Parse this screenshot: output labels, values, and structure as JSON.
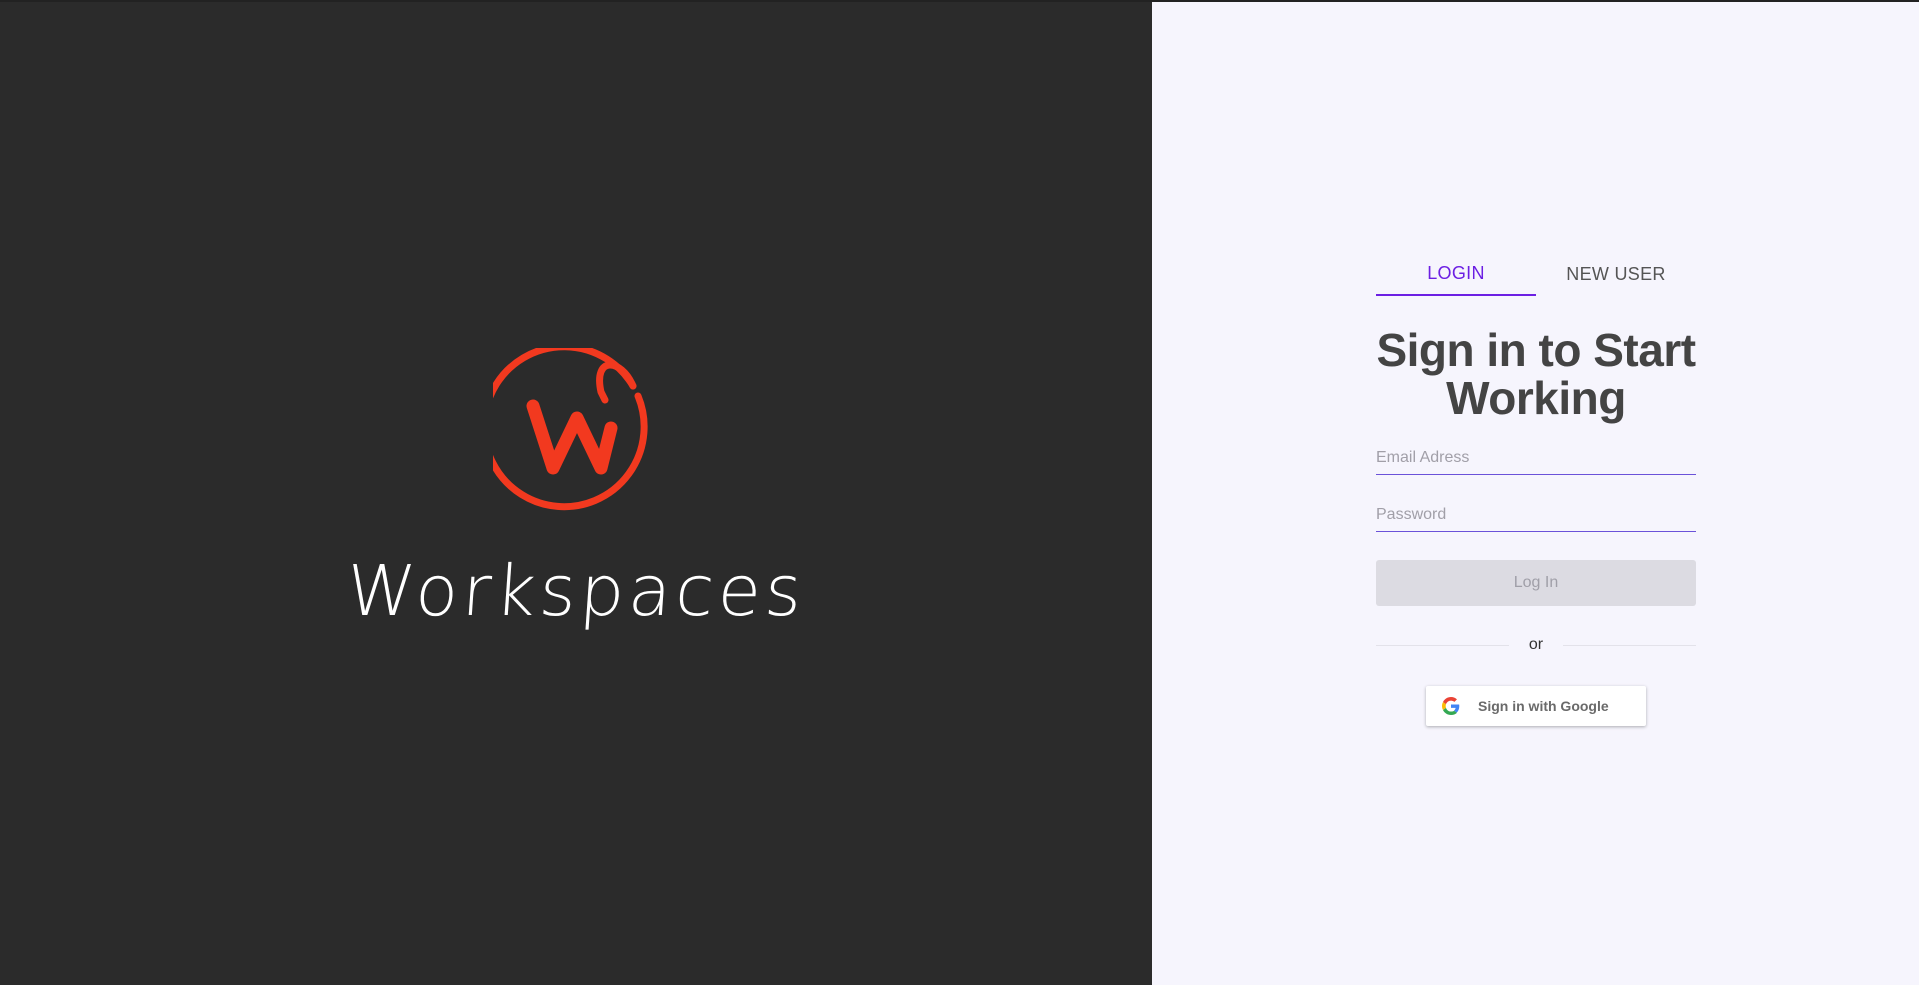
{
  "brand": {
    "name": "Workspaces",
    "logo_icon": "workspaces-w-logo-icon",
    "logo_color": "#f2391f"
  },
  "tabs": [
    {
      "label": "LOGIN",
      "active": true
    },
    {
      "label": "NEW USER",
      "active": false
    }
  ],
  "auth": {
    "heading": "Sign in to Start Working",
    "email": {
      "placeholder": "Email Adress",
      "value": ""
    },
    "password": {
      "placeholder": "Password",
      "value": ""
    },
    "login_label": "Log In",
    "divider_label": "or",
    "google_label": "Sign in with Google",
    "google_icon": "google-g-icon"
  },
  "colors": {
    "left_bg": "#2b2b2b",
    "right_bg": "#f6f5fd",
    "accent": "#6c1fe3"
  }
}
